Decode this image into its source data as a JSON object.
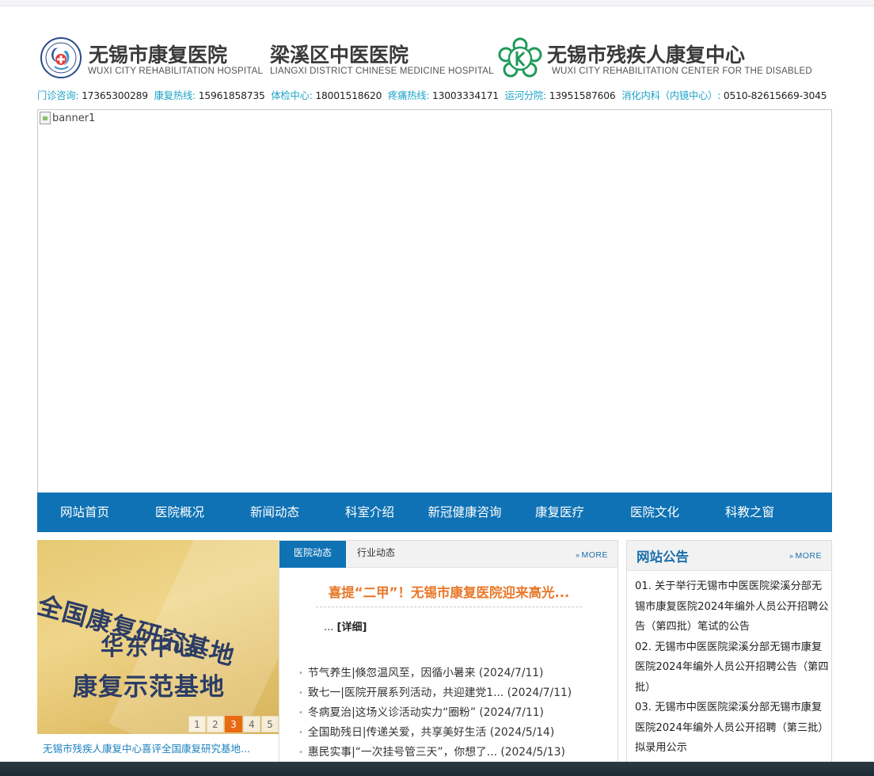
{
  "header": {
    "hospital1": {
      "name": "无锡市康复医院",
      "en": "WUXI CITY REHABILITATION HOSPITAL"
    },
    "hospital2": {
      "name": "梁溪区中医医院",
      "en": "LIANGXI DISTRICT CHINESE MEDICINE HOSPITAL"
    },
    "hospital3": {
      "name": "无锡市残疾人康复中心",
      "en": "WUXI CITY REHABILITATION CENTER FOR THE DISABLED"
    }
  },
  "hotlines": [
    {
      "label": "门诊咨询:",
      "value": "17365300289"
    },
    {
      "label": "康复热线:",
      "value": "15961858735"
    },
    {
      "label": "体检中心:",
      "value": "18001518620"
    },
    {
      "label": "疼痛热线:",
      "value": "13003334171"
    },
    {
      "label": "运河分院:",
      "value": "13951587606"
    },
    {
      "label": "消化内科（内镜中心）:",
      "value": "0510-82615669-3045"
    }
  ],
  "banner": {
    "alt": "banner1"
  },
  "nav": [
    "网站首页",
    "医院概况",
    "新闻动态",
    "科室介绍",
    "新冠健康咨询",
    "康复医疗",
    "医院文化",
    "科教之窗"
  ],
  "slider": {
    "plaque": [
      "全国康复研究基地",
      "华东中心",
      "康复示范基地"
    ],
    "pages": [
      "1",
      "2",
      "3",
      "4",
      "5"
    ],
    "active_page": "3",
    "caption": "无锡市残疾人康复中心喜评全国康复研究基地..."
  },
  "news": {
    "tabs": [
      "医院动态",
      "行业动态"
    ],
    "more": "MORE",
    "headline": "喜提“二甲”！无锡市康复医院迎来高光...",
    "snippet": "...",
    "detail": "[详细]",
    "items": [
      "节气养生|倏忽温风至，因循小暑来 (2024/7/11)",
      "致七一|医院开展系列活动，共迎建党1... (2024/7/11)",
      "冬病夏治|这场义诊活动实力“圈粉” (2024/7/11)",
      "全国助残日|传递关爱，共享美好生活 (2024/5/14)",
      "惠民实事|“一次挂号管三天”，你想了... (2024/5/13)"
    ]
  },
  "notice": {
    "title": "网站公告",
    "more": "MORE",
    "items": [
      "01.  关于举行无锡市中医医院梁溪分部无锡市康复医院2024年编外人员公开招聘公告（第四批）笔试的公告",
      "02.  无锡市中医医院梁溪分部无锡市康复医院2024年编外人员公开招聘公告（第四批）",
      "03.  无锡市中医医院梁溪分部无锡市康复医院2024年编外人员公开招聘（第三批）拟录用公示"
    ]
  },
  "colors": {
    "nav_bg": "#0f72b4",
    "accent_orange": "#e8792b",
    "hotline_label": "#1aa3c9",
    "link_blue": "#1a6fab"
  }
}
